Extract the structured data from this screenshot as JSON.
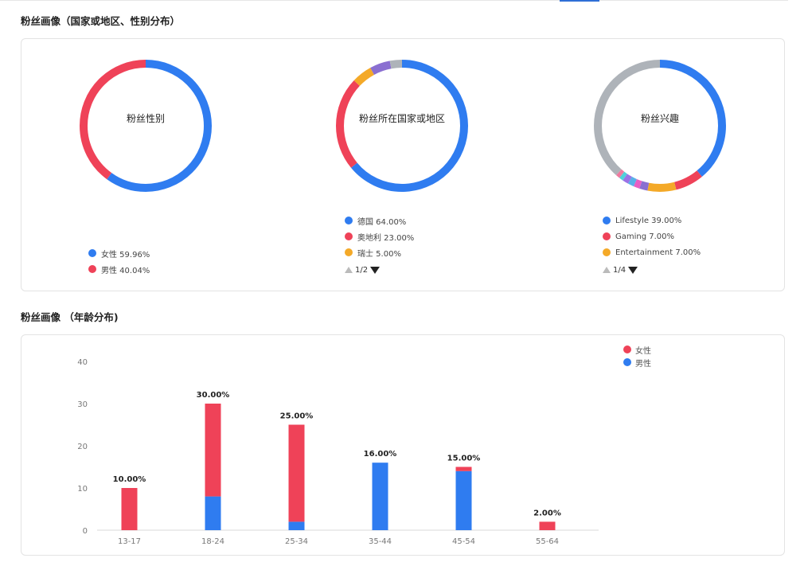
{
  "section1_title": "粉丝画像（国家或地区、性别分布）",
  "section2_title": "粉丝画像 （年龄分布)",
  "colors": {
    "blue": "#2f7cf0",
    "red": "#ef4258",
    "orange": "#f4a928",
    "purple": "#8a6fd1",
    "gray": "#aeb3b9"
  },
  "donuts": [
    {
      "center_label": "粉丝性别",
      "segments": [
        {
          "value": 59.96,
          "color": "#2f7cf0"
        },
        {
          "value": 40.04,
          "color": "#ef4258"
        }
      ],
      "legend": [
        {
          "text": "女性 59.96%",
          "color": "#2f7cf0"
        },
        {
          "text": "男性 40.04%",
          "color": "#ef4258"
        }
      ]
    },
    {
      "center_label": "粉丝所在国家或地区",
      "segments": [
        {
          "value": 64.0,
          "color": "#2f7cf0"
        },
        {
          "value": 23.0,
          "color": "#ef4258"
        },
        {
          "value": 5.0,
          "color": "#f4a928"
        },
        {
          "value": 5.0,
          "color": "#8a6fd1"
        },
        {
          "value": 3.0,
          "color": "#aeb3b9"
        }
      ],
      "legend": [
        {
          "text": "德国 64.00%",
          "color": "#2f7cf0"
        },
        {
          "text": "奥地利 23.00%",
          "color": "#ef4258"
        },
        {
          "text": "瑞士 5.00%",
          "color": "#f4a928"
        }
      ],
      "pager": "1/2"
    },
    {
      "center_label": "粉丝兴趣",
      "segments": [
        {
          "value": 39.0,
          "color": "#2f7cf0"
        },
        {
          "value": 7.0,
          "color": "#ef4258"
        },
        {
          "value": 7.0,
          "color": "#f4a928"
        },
        {
          "value": 2.0,
          "color": "#8a6fd1"
        },
        {
          "value": 1.5,
          "color": "#e85fc4"
        },
        {
          "value": 1.5,
          "color": "#5ab0e8"
        },
        {
          "value": 1.5,
          "color": "#9b72e6"
        },
        {
          "value": 1.0,
          "color": "#4fd1d9"
        },
        {
          "value": 1.0,
          "color": "#f07aa0"
        },
        {
          "value": 38.5,
          "color": "#aeb3b9"
        }
      ],
      "legend": [
        {
          "text": "Lifestyle 39.00%",
          "color": "#2f7cf0"
        },
        {
          "text": "Gaming 7.00%",
          "color": "#ef4258"
        },
        {
          "text": "Entertainment 7.00%",
          "color": "#f4a928"
        }
      ],
      "pager": "1/4"
    }
  ],
  "chart_data": {
    "type": "bar",
    "stacked": true,
    "categories": [
      "13-17",
      "18-24",
      "25-34",
      "35-44",
      "45-54",
      "55-64"
    ],
    "series": [
      {
        "name": "女性",
        "color": "#ef4258",
        "values": [
          10,
          22,
          23,
          0,
          1,
          2
        ]
      },
      {
        "name": "男性",
        "color": "#2f7cf0",
        "values": [
          0,
          8,
          2,
          16,
          14,
          0
        ]
      }
    ],
    "totals_labels": [
      "10.00%",
      "30.00%",
      "25.00%",
      "16.00%",
      "15.00%",
      "2.00%"
    ],
    "y_ticks": [
      "0",
      "10",
      "20",
      "30",
      "40"
    ],
    "ylim": [
      0,
      40
    ],
    "legend_position": "top-right",
    "grid": false
  }
}
